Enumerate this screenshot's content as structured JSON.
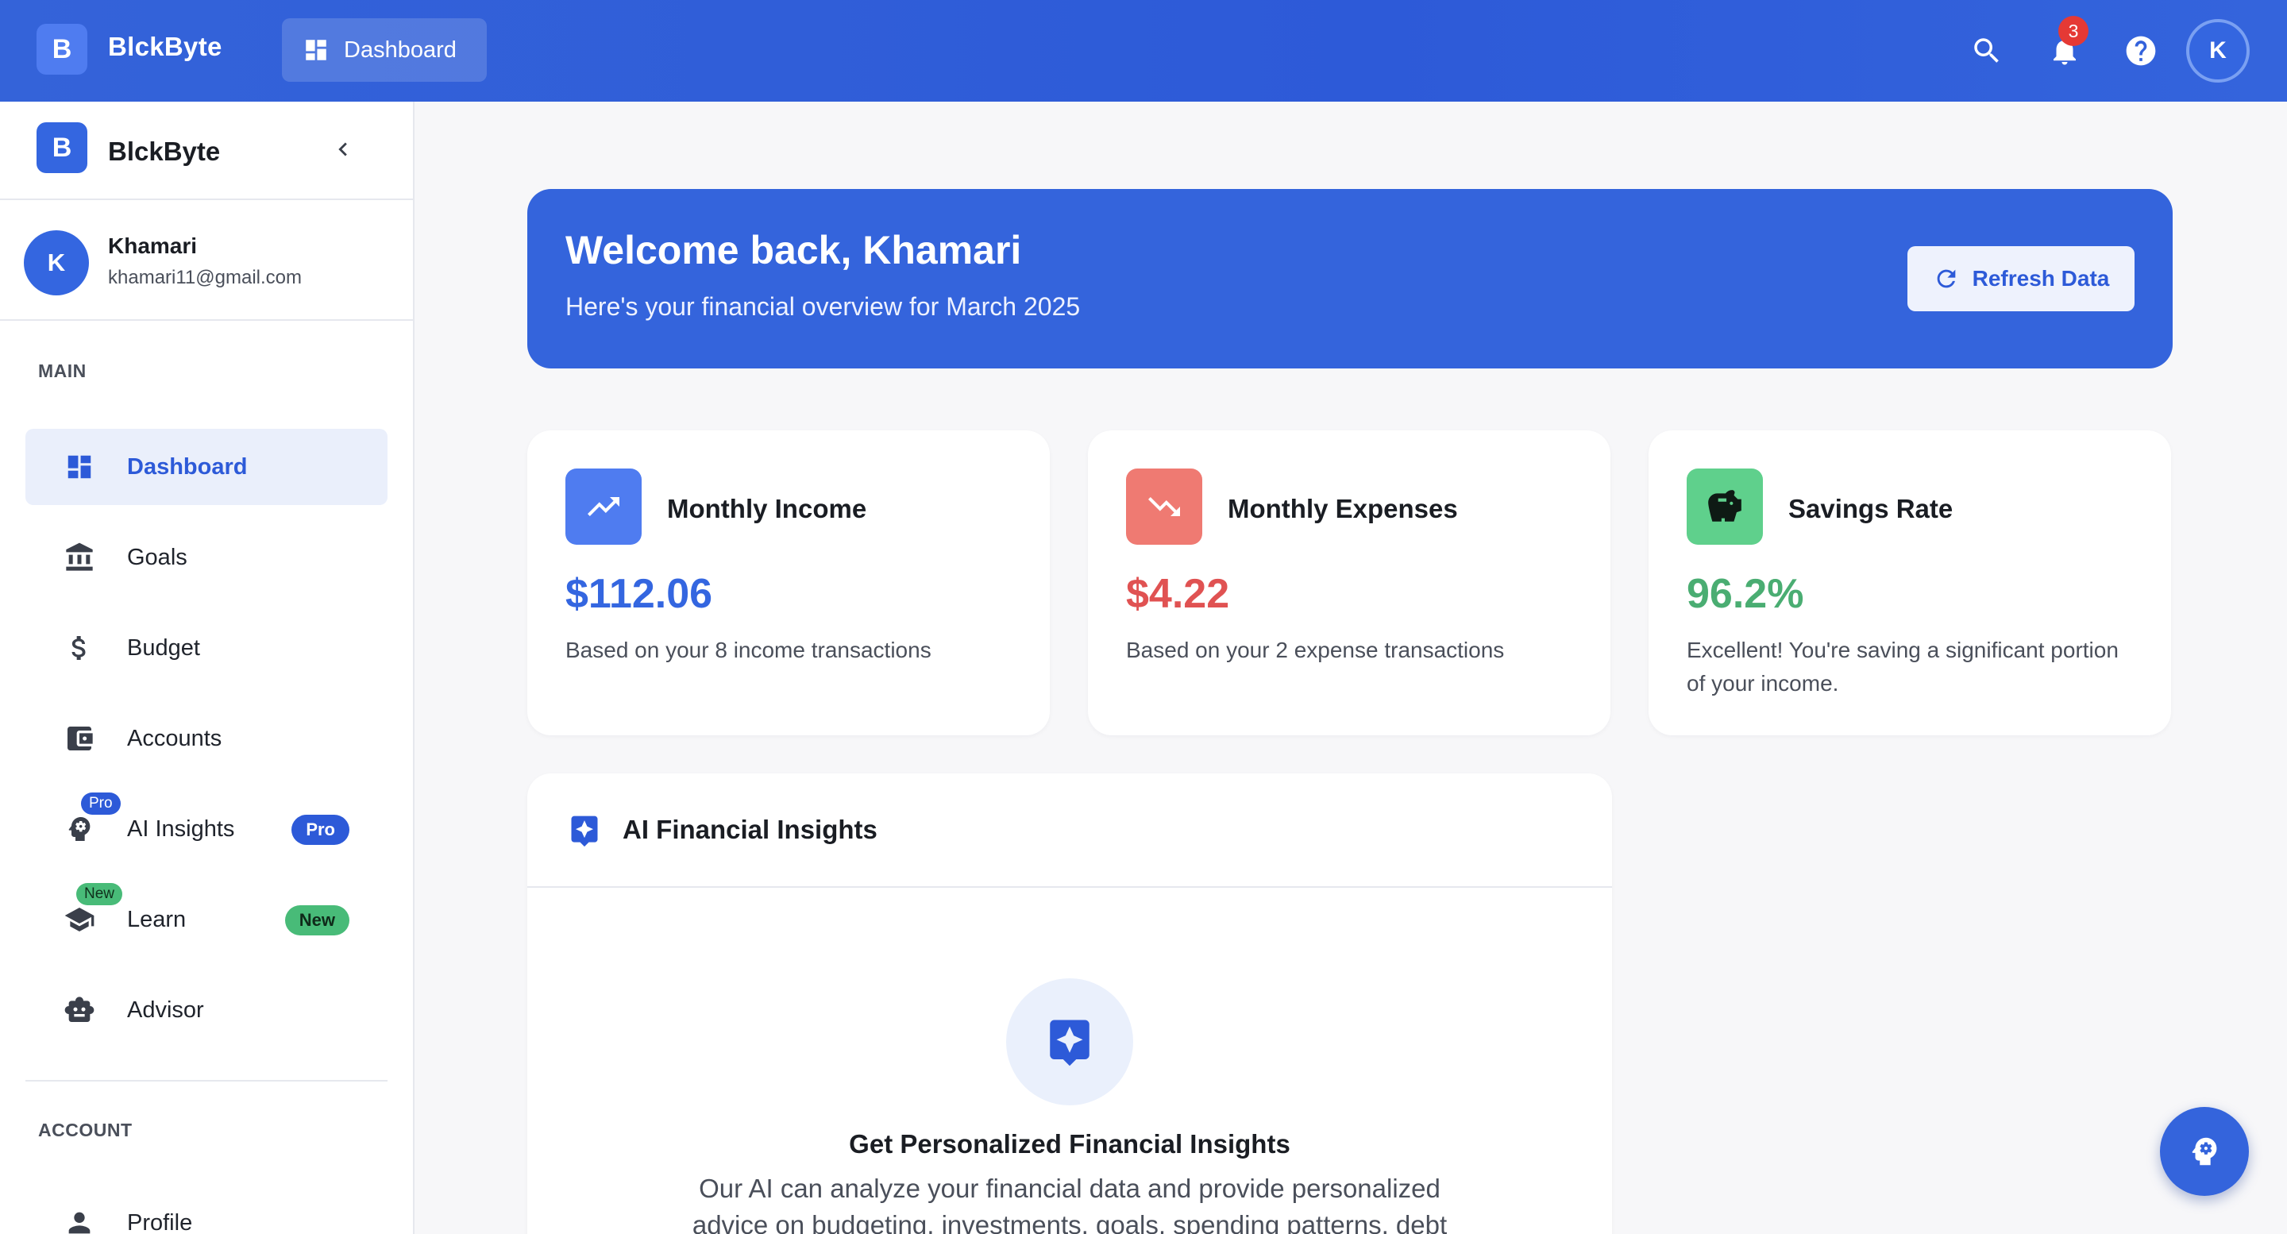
{
  "app": {
    "brand_initial": "B",
    "brand_name": "BlckByte"
  },
  "topbar": {
    "tab_label": "Dashboard",
    "notification_count": "3",
    "user_initial": "K"
  },
  "sidebar": {
    "brand_initial": "B",
    "brand_name": "BlckByte",
    "user": {
      "initial": "K",
      "name": "Khamari",
      "email": "khamari11@gmail.com"
    },
    "main_label": "MAIN",
    "items": [
      {
        "label": "Dashboard",
        "icon": "dashboard-icon",
        "active": true
      },
      {
        "label": "Goals",
        "icon": "bank-icon"
      },
      {
        "label": "Budget",
        "icon": "dollar-icon"
      },
      {
        "label": "Accounts",
        "icon": "wallet-icon"
      },
      {
        "label": "AI Insights",
        "icon": "ai-head-icon",
        "mini_badge": "Pro",
        "badge": "Pro"
      },
      {
        "label": "Learn",
        "icon": "school-icon",
        "mini_badge": "New",
        "badge": "New"
      },
      {
        "label": "Advisor",
        "icon": "robot-icon"
      }
    ],
    "account_label": "ACCOUNT",
    "account_items": [
      {
        "label": "Profile",
        "icon": "person-icon"
      }
    ]
  },
  "welcome": {
    "title": "Welcome back, Khamari",
    "subtitle": "Here's your financial overview for March 2025",
    "refresh_label": "Refresh Data"
  },
  "stats": [
    {
      "title": "Monthly Income",
      "value": "$112.06",
      "desc": "Based on your 8 income transactions",
      "color": "#3466e0",
      "icon_bg": "#4f7cf0",
      "icon": "trending-up-icon"
    },
    {
      "title": "Monthly Expenses",
      "value": "$4.22",
      "desc": "Based on your 2 expense transactions",
      "color": "#e05252",
      "icon_bg": "#ef7a72",
      "icon": "trending-down-icon"
    },
    {
      "title": "Savings Rate",
      "value": "96.2%",
      "desc": "Excellent! You're saving a significant portion of your income.",
      "color": "#4aad72",
      "icon_bg": "#5fd08c",
      "icon": "piggy-bank-icon"
    }
  ],
  "insights": {
    "title": "AI Financial Insights",
    "panel_title": "Get Personalized Financial Insights",
    "panel_desc": "Our AI can analyze your financial data and provide personalized advice on budgeting, investments, goals, spending patterns, debt"
  },
  "colors": {
    "primary": "#3464dc",
    "accent_green": "#48bb78",
    "danger": "#e53935"
  }
}
